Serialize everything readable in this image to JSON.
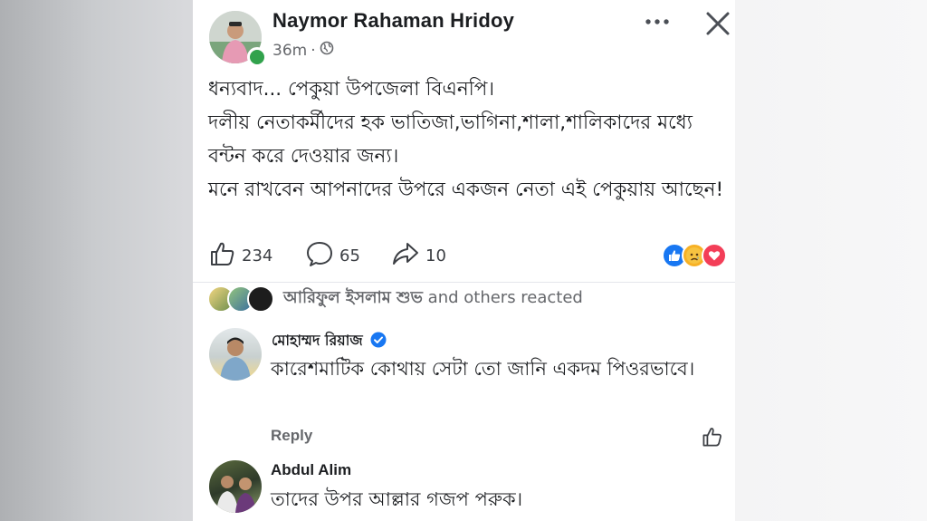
{
  "post": {
    "author": "Naymor Rahaman Hridoy",
    "time": "36m",
    "visibility_dot": "·",
    "visibility_icon": "globe-icon",
    "paragraphs": [
      "ধন্যবাদ... পেকুয়া উপজেলা বিএনপি।",
      "দলীয় নেতাকর্মীদের হক ভাতিজা,ভাগিনা,শালা,শালিকাদের মধ্যে বন্টন করে দেওয়ার জন্য।",
      "মনে রাখবেন আপনাদের উপরে একজন নেতা এই পেকুয়ায় আছেন!"
    ],
    "like_count": "234",
    "comment_count": "65",
    "share_count": "10",
    "reactions": [
      "like",
      "sad",
      "love"
    ],
    "colors": {
      "like": "#1877f2",
      "love": "#f33e58",
      "sad": "#f7b125",
      "online": "#31a24c"
    }
  },
  "reacted": {
    "name": "আরিফুল ইসলাম শুভ",
    "suffix": " and others reacted"
  },
  "comments": [
    {
      "author": "মোহাম্মদ রিয়াজ",
      "verified": true,
      "text": "কারেশমাটিক কোথায় সেটা তো জানি একদম পিওরভাবে।",
      "reply_label": "Reply"
    },
    {
      "author": "Abdul Alim",
      "text": "তাদের উপর আল্লার গজপ পরুক।"
    }
  ]
}
